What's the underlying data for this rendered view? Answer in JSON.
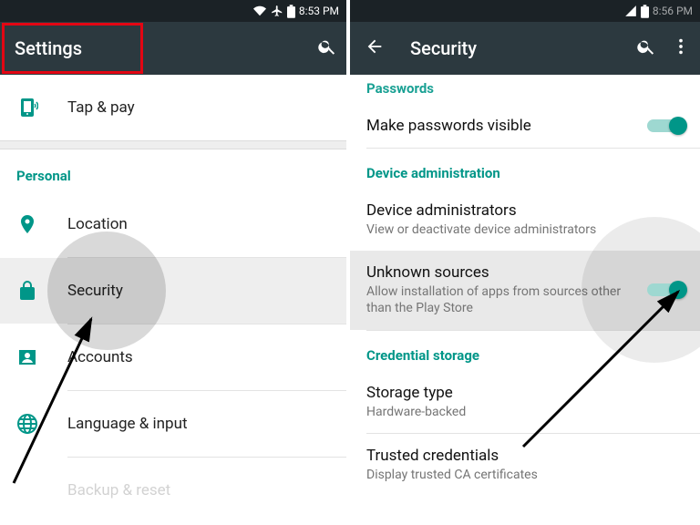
{
  "left": {
    "statusbar_time": "8:53 PM",
    "app_title": "Settings",
    "top_item": "Tap & pay",
    "section_personal": "Personal",
    "items": {
      "location": "Location",
      "security": "Security",
      "accounts": "Accounts",
      "language": "Language & input",
      "backup": "Backup & reset"
    }
  },
  "right": {
    "statusbar_time": "8:56 PM",
    "app_title": "Security",
    "section_passwords": "Passwords",
    "make_pw_visible": "Make passwords visible",
    "section_device_admin": "Device administration",
    "device_admins_title": "Device administrators",
    "device_admins_sub": "View or deactivate device administrators",
    "unknown_title": "Unknown sources",
    "unknown_sub": "Allow installation of apps from sources other than the Play Store",
    "section_cred": "Credential storage",
    "storage_title": "Storage type",
    "storage_sub": "Hardware-backed",
    "trusted_title": "Trusted credentials",
    "trusted_sub": "Display trusted CA certificates"
  }
}
